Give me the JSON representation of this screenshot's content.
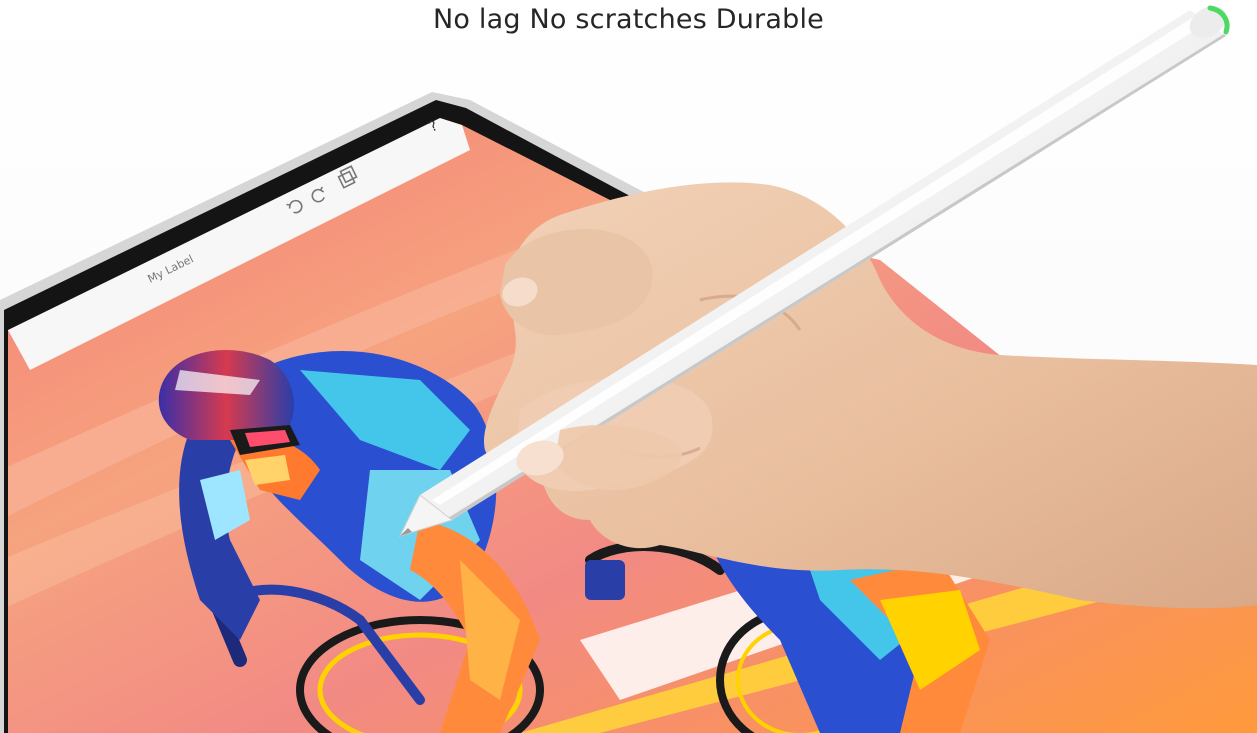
{
  "banner": {
    "tagline": "No lag No scratches Durable"
  },
  "tablet": {
    "toolbar_text": "My Label"
  },
  "colors": {
    "tablet_frame": "#1a1a1a",
    "canvas_pink": "#f2888a",
    "canvas_orange": "#ff8a3c",
    "cyclist_blue": "#2a4fd0",
    "cyclist_cyan": "#43c6ea",
    "stylus_white": "#f4f4f4",
    "stylus_cap_green": "#4cd964",
    "skin": "#e9c4a6"
  },
  "icons": [
    "undo-icon",
    "redo-icon",
    "layers-icon",
    "help-icon"
  ]
}
